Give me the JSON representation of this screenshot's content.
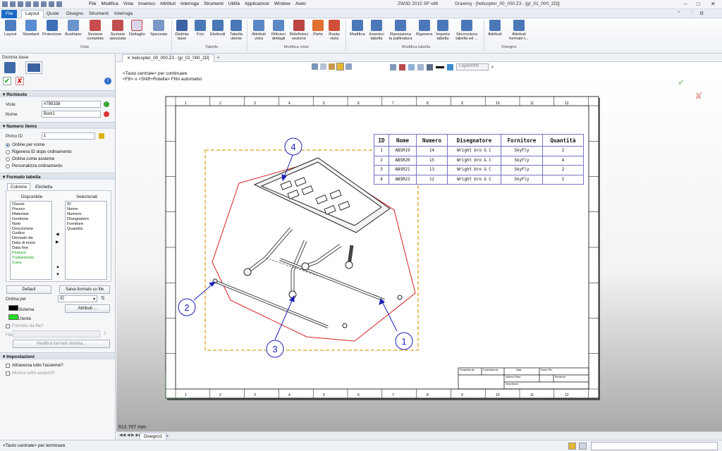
{
  "menubar": {
    "menus": [
      "File",
      "Modifica",
      "Vista",
      "Inserisci",
      "Attributi",
      "Interroga",
      "Strumenti",
      "Utilità",
      "Applicazioni",
      "Window",
      "Aiuto"
    ],
    "app_title": "ZW3D 2015 SP x86",
    "doc_title": "Drawing - [helicopter_00_000.Z3 - [gr_01_000_2D]]"
  },
  "ribbon_tabs": [
    "File",
    "Layout",
    "Quote",
    "Disegno",
    "Strumenti",
    "Interroga"
  ],
  "ribbon": {
    "groups": [
      "Viste",
      "Tabelle",
      "Modifica vista",
      "Modifica tabella",
      "Disegno"
    ],
    "buttons": {
      "layout": "Layout",
      "standard": "Standard",
      "proiezione": "Proiezione",
      "ausiliarie": "Ausiliarie",
      "sezione_completa": "Sezione completa",
      "sezione_spezzata": "Sezione spezzata",
      "dettaglio": "Dettaglio",
      "spezzata": "Spezzata",
      "distinta_base": "Distinta base",
      "fori": "Fori",
      "elettrodi": "Elettrodi",
      "tabella_utente": "Tabella utente",
      "attributi_vista": "Attributi vista",
      "rifinisci_dettagli": "Rifinisci dettagli",
      "ridefinisci_sezione": "Ridefinisci sezione",
      "parte": "Parte",
      "ruota_vista": "Ruota vista",
      "modifica": "Modifica",
      "inserisci_tabella": "Inserisci tabella",
      "riposiziona_pallinatura": "Riposiziona la pallinatura",
      "rigenera": "Rigenera",
      "importa_tabella": "Importa tabella",
      "sincronizza": "Sincronizza tabella ed ...",
      "attributi": "Attributi",
      "attributi_formato": "Attributi formato t..."
    }
  },
  "left_panel": {
    "title": "Distinta base",
    "richiesto": {
      "header": "Richiesto",
      "viste_label": "Viste",
      "viste_value": "#795338",
      "nome_label": "Nome",
      "nome_value": "Bom1"
    },
    "numero_items": {
      "header": "Numero items",
      "primo_id_label": "Primo ID",
      "primo_id_value": "1",
      "options": [
        "Ordine per nome",
        "Rigenera ID dopo ordinamento",
        "Ordina come assieme",
        "Personalizza ordinamento"
      ]
    },
    "formato_tabella": {
      "header": "Formato tabella",
      "tabs": [
        "Colonne",
        "Etichetta"
      ],
      "disponibile_label": "Disponibile",
      "selezionati_label": "Selezionati",
      "disponibile": [
        "Classe",
        "Prezzo",
        "Materiale",
        "Gestione",
        "Note",
        "Descrizione",
        "Codice",
        "Derivato da",
        "Data di inizio",
        "Data fine",
        "Finitura",
        "Trattamento",
        "Cava"
      ],
      "selezionati": [
        "ID",
        "Nome",
        "Numero",
        "Disegnatore",
        "Fornitore",
        "Quantità"
      ],
      "default_btn": "Default",
      "salva_btn": "Salva formato su file",
      "ordina_per_label": "Ordina per",
      "ordina_per_value": "ID",
      "sistema_label": "Sistema",
      "utente_label": "Utente",
      "attributi_btn": "Attributi ...",
      "formato_da_file": "Formato da file?",
      "file_label": "File",
      "modifica_btn": "Modifica formato distinta..."
    },
    "impostazioni": {
      "header": "Impostazioni",
      "attraversa": "Attraversa tutto l'assieme?",
      "mostra": "Mostra sotto-assiemi?"
    }
  },
  "document": {
    "tab": "helicopter_00_000.Z3 - [gr_01_000_2D]",
    "layer": "Layer0000",
    "prompt1": "<Tasto centrale> per continuare",
    "prompt2": "<F8> o <Shift+Rotella> Filtri automatici",
    "measure": "512.707 mm",
    "sheet": "Disegno1"
  },
  "bom_table": {
    "headers": [
      "ID",
      "Nome",
      "Numero",
      "Disegnatore",
      "Fornitore",
      "Quantità"
    ],
    "rows": [
      [
        "1",
        "ABSR19",
        "14",
        "Wright bro & C",
        "SkyFly",
        "2"
      ],
      [
        "2",
        "ABSR20",
        "15",
        "Wright bro & C",
        "SkyFly",
        "4"
      ],
      [
        "3",
        "ABSR21",
        "13",
        "Wright bro & C",
        "SkyFly",
        "2"
      ],
      [
        "4",
        "ABSR22",
        "12",
        "Wright bro & C",
        "SkyFly",
        "1"
      ]
    ]
  },
  "balloons": [
    "1",
    "2",
    "3",
    "4"
  ],
  "border_numbers": [
    "1",
    "2",
    "3",
    "4",
    "5",
    "6",
    "7",
    "8",
    "9",
    "10",
    "11",
    "12"
  ],
  "title_block": {
    "progettato_da": "Progettato da:",
    "controllato_da": "Controllato da:",
    "data": "Data:",
    "nome_file": "Nome File:",
    "numero_parte": "Numero Parte:",
    "revisione": "Revisione:",
    "descrizione": "Descrizione:"
  },
  "statusbar": {
    "message": "<Tasto centrale> per terminare"
  },
  "colors": {
    "accent": "#1c6ac6",
    "balloon": "#1d1fb8",
    "boundary": "#d62020",
    "frame": "#e0a21e",
    "sistema": "#000000",
    "utente": "#22dd22"
  }
}
